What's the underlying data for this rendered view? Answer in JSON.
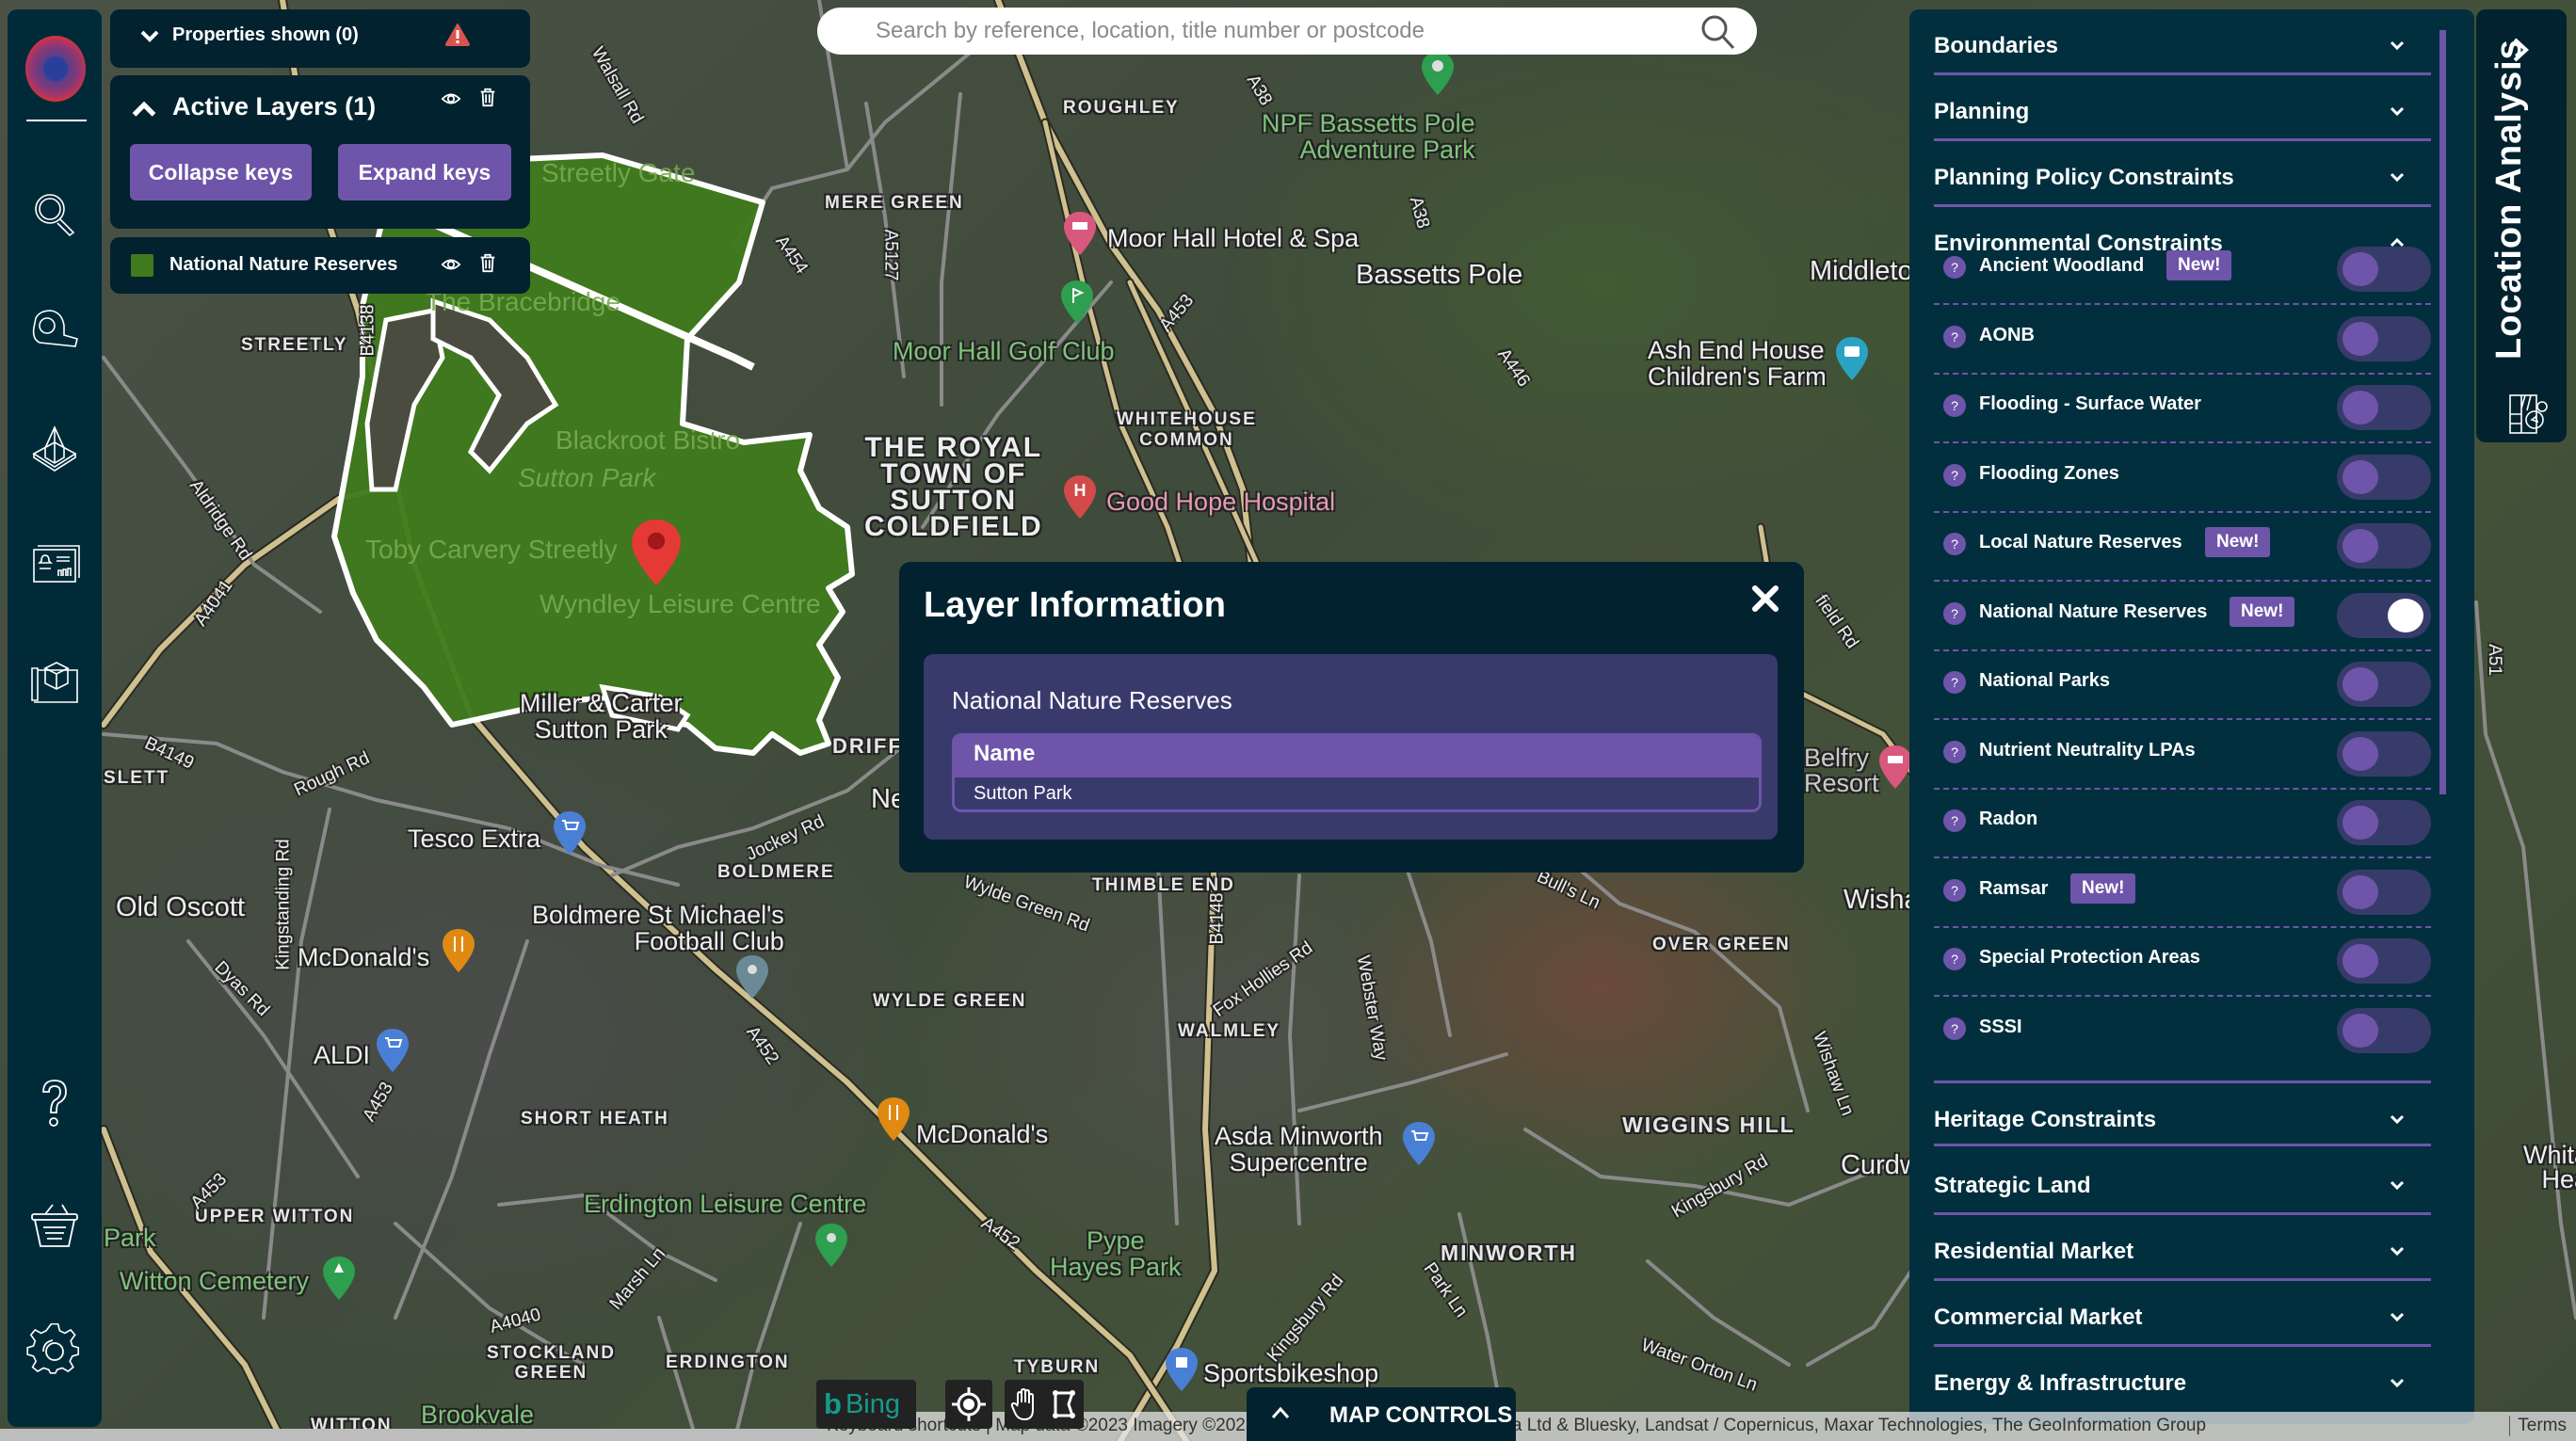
{
  "sidebar": {
    "items": [
      {
        "name": "search-properties",
        "icon": "magnifier-icon"
      },
      {
        "name": "measure",
        "icon": "tape-measure-icon"
      },
      {
        "name": "site-builder",
        "icon": "house-plot-icon"
      },
      {
        "name": "alerts-report",
        "icon": "alert-dashboard-icon"
      },
      {
        "name": "plans",
        "icon": "blueprint-box-icon"
      },
      {
        "name": "help",
        "icon": "question-icon"
      },
      {
        "name": "basket",
        "icon": "basket-icon"
      },
      {
        "name": "settings",
        "icon": "gear-icon"
      }
    ]
  },
  "properties_panel": {
    "label": "Properties shown (0)",
    "warning_icon": "warning-triangle-icon"
  },
  "active_layers": {
    "title": "Active Layers (1)",
    "collapse_label": "Collapse keys",
    "expand_label": "Expand keys",
    "layers": [
      {
        "name": "National Nature Reserves",
        "color": "#3f7a1c"
      }
    ]
  },
  "search": {
    "placeholder": "Search by reference, location, title number or postcode",
    "value": ""
  },
  "layer_info": {
    "title": "Layer Information",
    "layer_name": "National Nature Reserves",
    "table": {
      "header": "Name",
      "rows": [
        "Sutton Park"
      ]
    }
  },
  "right_panel": {
    "sections_top": [
      {
        "label": "Boundaries",
        "expanded": false
      },
      {
        "label": "Planning",
        "expanded": false
      },
      {
        "label": "Planning Policy Constraints",
        "expanded": false
      }
    ],
    "environmental": {
      "label": "Environmental Constraints",
      "expanded": true,
      "layers": [
        {
          "label": "Ancient Woodland",
          "badge": "New!",
          "on": false
        },
        {
          "label": "AONB",
          "badge": "",
          "on": false
        },
        {
          "label": "Flooding - Surface Water",
          "badge": "",
          "on": false
        },
        {
          "label": "Flooding Zones",
          "badge": "",
          "on": false
        },
        {
          "label": "Local Nature Reserves",
          "badge": "New!",
          "on": false
        },
        {
          "label": "National Nature Reserves",
          "badge": "New!",
          "on": true
        },
        {
          "label": "National Parks",
          "badge": "",
          "on": false
        },
        {
          "label": "Nutrient Neutrality LPAs",
          "badge": "",
          "on": false
        },
        {
          "label": "Radon",
          "badge": "",
          "on": false
        },
        {
          "label": "Ramsar",
          "badge": "New!",
          "on": false
        },
        {
          "label": "Special Protection Areas",
          "badge": "",
          "on": false
        },
        {
          "label": "SSSI",
          "badge": "",
          "on": false
        }
      ]
    },
    "sections_bottom": [
      {
        "label": "Heritage Constraints",
        "expanded": false
      },
      {
        "label": "Strategic Land",
        "expanded": false
      },
      {
        "label": "Residential Market",
        "expanded": false
      },
      {
        "label": "Commercial Market",
        "expanded": false
      },
      {
        "label": "Energy & Infrastructure",
        "expanded": false
      }
    ],
    "help_glyph": "?"
  },
  "location_tab": {
    "label": "Location Analysis"
  },
  "map_controls": {
    "label": "MAP CONTROLS"
  },
  "bing": {
    "logo": "b",
    "text": "Bing"
  },
  "attribution": {
    "text": "Keyboard shortcuts | Map data ©2023 Imagery ©2023 Airbus, Getmapping plc, Infoterra Ltd & Bluesky, Landsat / Copernicus, Maxar Technologies, The GeoInformation Group",
    "terms": "Terms"
  },
  "colors": {
    "accent": "#6e55aa",
    "panel": "#01222e",
    "panel_alt": "#012f3e",
    "layer_green": "#3f7a1c",
    "card": "#393a6c"
  },
  "map": {
    "labels": {
      "roughley": "ROUGHLEY",
      "mere_green": "MERE GREEN",
      "streetly": "STREETLY",
      "npf": "NPF Bassetts Pole\nAdventure Park",
      "moor_hall_hotel": "Moor Hall Hotel & Spa",
      "bassetts_pole": "Bassetts Pole",
      "moor_hall_golf": "Moor Hall Golf Club",
      "middleton": "Middleto",
      "ash_end": "Ash End House\nChildren's Farm",
      "whitehouse": "WHITEHOUSE\nCOMMON",
      "royal_town": "THE ROYAL\nTOWN OF\nSUTTON\nCOLDFIELD",
      "good_hope": "Good Hope Hospital",
      "kingsbury": "gsbury",
      "bracebridge": "The Bracebridge",
      "blackroot": "Blackroot Bistro",
      "sutton_park": "Sutton Park",
      "toby": "Toby Carvery Streetly",
      "wyndley": "Wyndley Leisure Centre",
      "miller": "Miller & Carter\nSutton Park",
      "streetly_gate": "Streetly Gate",
      "drift": "DRIFF",
      "ne": "Ne",
      "belfry": "Belfry\nResort",
      "wisha": "Wisha",
      "slett": "SLETT",
      "tesco": "Tesco Extra",
      "boldmere": "BOLDMERE",
      "old_oscott": "Old Oscott",
      "boldmere_fc": "Boldmere St Michael's\nFootball Club",
      "mcdonalds1": "McDonald's",
      "aldi": "ALDI",
      "wylde_green": "WYLDE GREEN",
      "thimble_end": "THIMBLE END",
      "over_green": "OVER GREEN",
      "walmley": "WALMLEY",
      "short_heath": "SHORT HEATH",
      "mcdonalds2": "McDonald's",
      "asda": "Asda Minworth\nSupercentre",
      "wiggins": "WIGGINS HILL",
      "curdw": "Curdw",
      "upper_witton": "UPPER WITTON",
      "erdington_lc": "Erdington Leisure Centre",
      "pype": "Pype\nHayes Park",
      "park": "Park",
      "witton_cem": "Witton Cemetery",
      "minworth": "MINWORTH",
      "stockland": "STOCKLAND\nGREEN",
      "erdington": "ERDINGTON",
      "tyburn": "TYBURN",
      "sportsbike": "Sportsbikeshop",
      "witton": "WITTON",
      "brookvale": "Brookvale",
      "whita": "Whita\nHea",
      "r_a38": "A38",
      "r_a38b": "A38",
      "r_a446": "A446",
      "r_a453": "A453",
      "r_a454": "A454",
      "r_a5127": "A5127",
      "r_b4138": "B4138",
      "r_aldridge": "Aldridge Rd",
      "r_a4041": "A4041",
      "r_b4149": "B4149",
      "r_rough": "Rough Rd",
      "r_jockey": "Jockey Rd",
      "r_kingstanding": "Kingstanding Rd",
      "r_dyas": "Dyas Rd",
      "r_a452": "A452",
      "r_wylde": "Wylde Green Rd",
      "r_b4148": "B4148",
      "r_fox": "Fox Hollies Rd",
      "r_webster": "Webster Way",
      "r_bulls": "Bull's Ln",
      "r_wishaw": "Wishaw Ln",
      "r_kingsbury": "Kingsbury Rd",
      "r_kingsbury2": "Kingsbury Rd",
      "r_park": "Park Ln",
      "r_water": "Water Orton Ln",
      "r_marsh": "Marsh Ln",
      "r_a4040": "A4040",
      "r_a51": "A51",
      "r_walsall": "Walsall Rd",
      "r_field": "field Rd",
      "r_a452b": "A452",
      "r_a453b": "A453",
      "r_a453c": "A453"
    }
  }
}
